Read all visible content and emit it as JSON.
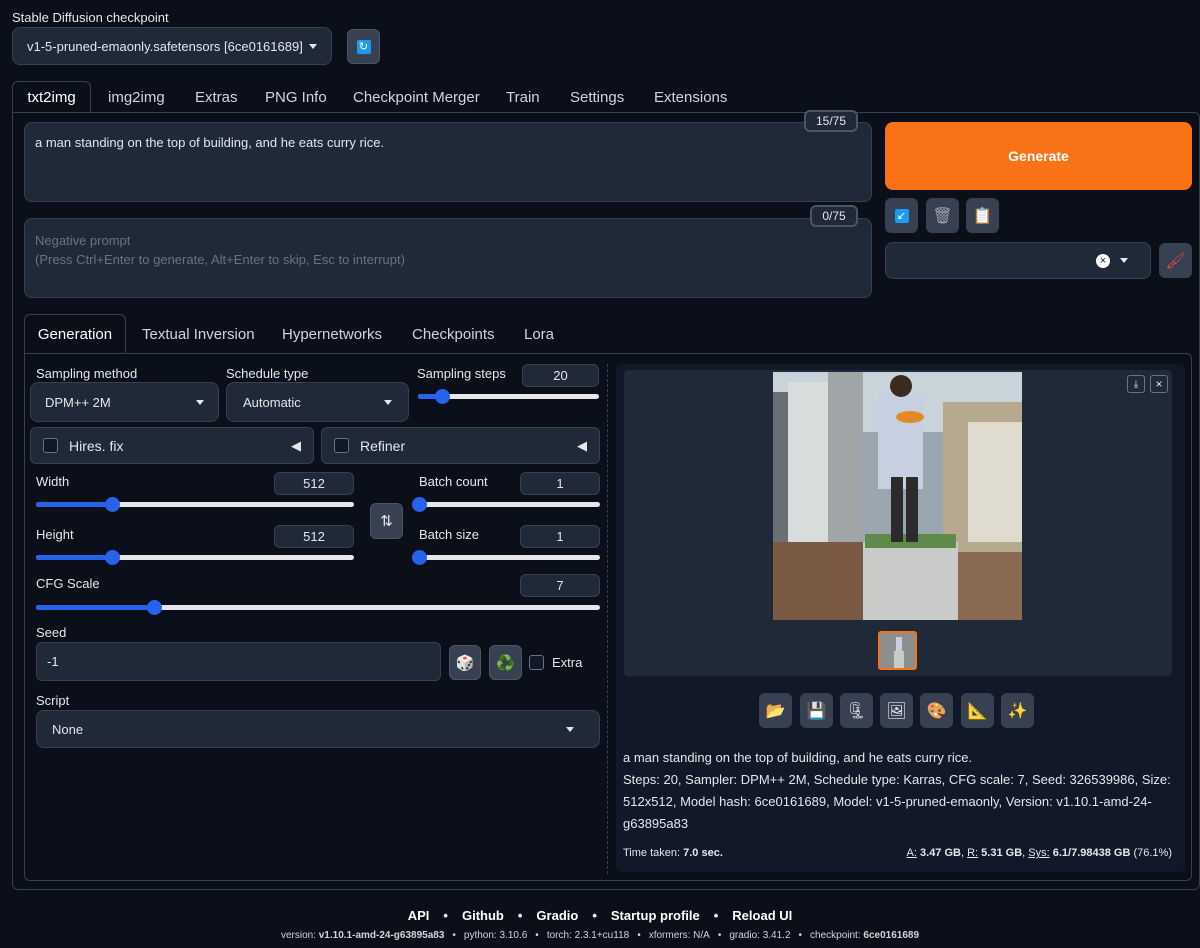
{
  "checkpoint": {
    "label": "Stable Diffusion checkpoint",
    "selected": "v1-5-pruned-emaonly.safetensors [6ce0161689]"
  },
  "main_tabs": [
    "txt2img",
    "img2img",
    "Extras",
    "PNG Info",
    "Checkpoint Merger",
    "Train",
    "Settings",
    "Extensions"
  ],
  "prompt": {
    "value": "a man standing on the top of building,  and he eats curry rice.",
    "token_count": "15/75"
  },
  "negative_prompt": {
    "placeholder_line1": "Negative prompt",
    "placeholder_line2": "(Press Ctrl+Enter to generate, Alt+Enter to skip, Esc to interrupt)",
    "token_count": "0/75"
  },
  "generate_label": "Generate",
  "sub_tabs": [
    "Generation",
    "Textual Inversion",
    "Hypernetworks",
    "Checkpoints",
    "Lora"
  ],
  "generation": {
    "sampling_method": {
      "label": "Sampling method",
      "value": "DPM++ 2M"
    },
    "schedule_type": {
      "label": "Schedule type",
      "value": "Automatic"
    },
    "sampling_steps": {
      "label": "Sampling steps",
      "value": "20",
      "fraction": 0.13
    },
    "hires_fix": "Hires. fix",
    "refiner": "Refiner",
    "width": {
      "label": "Width",
      "value": "512",
      "fraction": 0.24
    },
    "height": {
      "label": "Height",
      "value": "512",
      "fraction": 0.24
    },
    "batch_count": {
      "label": "Batch count",
      "value": "1",
      "fraction": 0.0
    },
    "batch_size": {
      "label": "Batch size",
      "value": "1",
      "fraction": 0.0
    },
    "cfg_scale": {
      "label": "CFG Scale",
      "value": "7",
      "fraction": 0.21
    },
    "seed": {
      "label": "Seed",
      "value": "-1"
    },
    "extra": "Extra",
    "script": {
      "label": "Script",
      "value": "None"
    }
  },
  "output": {
    "info_prompt": "a man standing on the top of building, and he eats curry rice.",
    "info_params_line1": "Steps: 20, Sampler: DPM++ 2M, Schedule type: Karras, CFG scale: 7, Seed: 326539986, Size:",
    "info_params_line2": "512x512, Model hash: 6ce0161689, Model: v1-5-pruned-emaonly, Version: v1.10.1-amd-24-",
    "info_params_line3": "g63895a83",
    "time_label": "Time taken:",
    "time_value": "7.0 sec.",
    "vram_a_label": "A:",
    "vram_a": "3.47 GB",
    "vram_r_label": "R:",
    "vram_r": "5.31 GB",
    "vram_sys_label": "Sys:",
    "vram_sys": "6.1/7.98438 GB",
    "vram_pct": "(76.1%)"
  },
  "footer": {
    "links": [
      "API",
      "Github",
      "Gradio",
      "Startup profile",
      "Reload UI"
    ],
    "version_label": "version:",
    "version": "v1.10.1-amd-24-g63895a83",
    "python": "python: 3.10.6",
    "torch": "torch: 2.3.1+cu118",
    "xformers": "xformers: N/A",
    "gradio": "gradio: 3.41.2",
    "checkpoint_label": "checkpoint:",
    "checkpoint": "6ce0161689"
  },
  "colors": {
    "accent": "#2563eb",
    "generate": "#f97316",
    "background": "#0b0f19",
    "panel": "#1f2937"
  }
}
